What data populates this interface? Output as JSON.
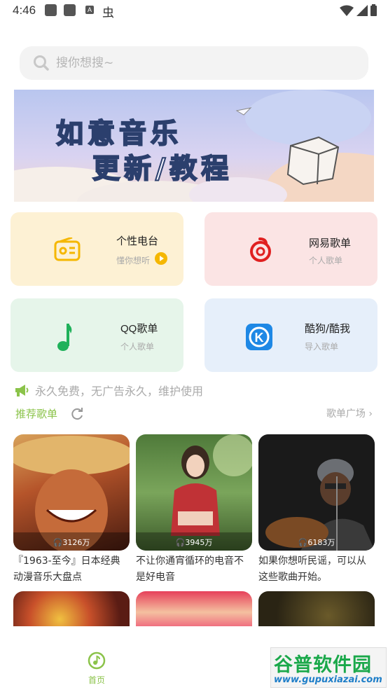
{
  "status_bar": {
    "time": "4:46",
    "a_label": "A",
    "bug_glyph": "虫"
  },
  "search": {
    "placeholder": "搜你想搜~"
  },
  "banner": {
    "line1": "如意音乐",
    "line2": "更新/教程"
  },
  "cards": [
    {
      "title": "个性电台",
      "subtitle": "懂你想听",
      "icon": "radio-icon",
      "bg": "#fdf1d4"
    },
    {
      "title": "网易歌单",
      "subtitle": "个人歌单",
      "icon": "netease-icon",
      "bg": "#fbe4e4"
    },
    {
      "title": "QQ歌单",
      "subtitle": "个人歌单",
      "icon": "qq-music-icon",
      "bg": "#e6f5ea"
    },
    {
      "title": "酷狗/酷我",
      "subtitle": "导入歌单",
      "icon": "kugou-icon",
      "bg": "#e6effa"
    }
  ],
  "notice": {
    "text": "永久免费，无广告永久，维护使用"
  },
  "recommend": {
    "title": "推荐歌单",
    "more": "歌单广场"
  },
  "playlists": [
    {
      "plays": "3126万",
      "title": "『1963-至今』日本经典动漫音乐大盘点"
    },
    {
      "plays": "3945万",
      "title": "不让你通宵循环的电音不是好电音"
    },
    {
      "plays": "6183万",
      "title": "如果你想听民谣，可以从这些歌曲开始。"
    }
  ],
  "tabbar": {
    "home_label": "首页"
  },
  "watermark": {
    "line1": "谷普软件园",
    "line2": "www.gupuxiazai.com"
  },
  "colors": {
    "accent": "#8bc34a",
    "card_radio_icon": "#f5b700",
    "netease": "#e02020",
    "qq": "#1fb15a",
    "kugou": "#1e88e5"
  }
}
